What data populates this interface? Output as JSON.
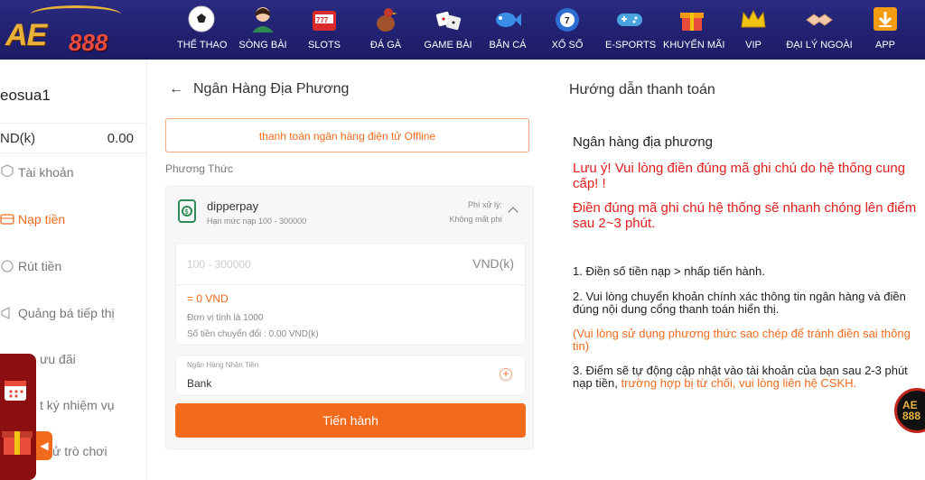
{
  "brand": {
    "logo_text": "AE",
    "logo_num": "888",
    "colors": {
      "accent": "#f26b1d",
      "nav_bg": "#1f1f6e",
      "warning": "#e31d1d"
    }
  },
  "nav": [
    {
      "label": "THỂ THAO",
      "icon": "soccer-ball-icon"
    },
    {
      "label": "SÒNG BÀI",
      "icon": "casino-dealer-icon"
    },
    {
      "label": "SLOTS",
      "icon": "slot-machine-icon"
    },
    {
      "label": "ĐÁ GÀ",
      "icon": "rooster-icon"
    },
    {
      "label": "GAME BÀI",
      "icon": "dice-icon"
    },
    {
      "label": "BẮN CÁ",
      "icon": "fish-icon"
    },
    {
      "label": "XỔ SỐ",
      "icon": "lottery-ball-icon"
    },
    {
      "label": "E-SPORTS",
      "icon": "gamepad-icon"
    },
    {
      "label": "KHUYẾN MÃI",
      "icon": "gift-icon"
    },
    {
      "label": "VIP",
      "icon": "crown-icon"
    },
    {
      "label": "ĐẠI LÝ NGOÀI",
      "icon": "handshake-icon"
    },
    {
      "label": "APP",
      "icon": "download-icon"
    }
  ],
  "sidebar": {
    "username": "eosua1",
    "balance_currency": "ND(k)",
    "balance_value": "0.00",
    "items": [
      {
        "label": "Tài khoản",
        "icon": "account-icon"
      },
      {
        "label": "Nạp tiền",
        "icon": "deposit-icon"
      },
      {
        "label": "Rút tiền",
        "icon": "withdraw-icon"
      },
      {
        "label": "Quảng bá tiếp thị",
        "icon": "promotion-icon"
      },
      {
        "label": "ưu đãi",
        "icon": "gift-box-icon"
      },
      {
        "label": "t ký nhiệm vụ",
        "icon": "calendar-icon"
      },
      {
        "label": "ử trò chơi",
        "icon": "history-icon"
      }
    ]
  },
  "deposit": {
    "title": "Ngân Hàng Địa Phương",
    "offline_tab": "thanh toán ngân hàng điện tử Offline",
    "method_label": "Phương Thức",
    "method": {
      "name": "dipperpay",
      "limit": "Hạn mức nạp 100 - 300000",
      "fee_label": "Phí xử lý:",
      "fee_value": "Không mất phí"
    },
    "amount_placeholder": "100 - 300000",
    "amount_unit": "VND(k)",
    "amount_equals": "= 0 VND",
    "unit_note": "Đơn vị tính là 1000",
    "converted": "Số tiền chuyển đổi : 0.00 VND(k)",
    "bank_label": "Ngân Hàng Nhận Tiền",
    "bank_value": "Bank",
    "proceed": "Tiến hành"
  },
  "guide": {
    "title": "Hướng dẫn thanh toán",
    "bank": "Ngân hàng địa phương",
    "warn1": "Lưu ý! Vui lòng điền đúng mã ghi chú do hệ thống cung cấp! !",
    "warn2": "Điền đúng mã ghi chú hệ thống sẽ nhanh chóng lên điểm sau 2~3 phút.",
    "step1": "1. Điền số tiền nạp > nhấp tiến hành.",
    "step2": "2. Vui lòng chuyển khoản chính xác thông tin ngân hàng và điền đúng nội dung cổng thanh toán hiển thị.",
    "note": " (Vui lòng sử dụng phương thức sao chép để tránh điền sai thông tin)",
    "step3_a": "3. Điểm sẽ tự động cập nhật vào tài khoản của bạn sau 2-3 phút nạp tiền, ",
    "step3_b": "trường hợp bị từ chối, vui lòng liên hệ CSKH."
  },
  "float_logo": "AE 888"
}
